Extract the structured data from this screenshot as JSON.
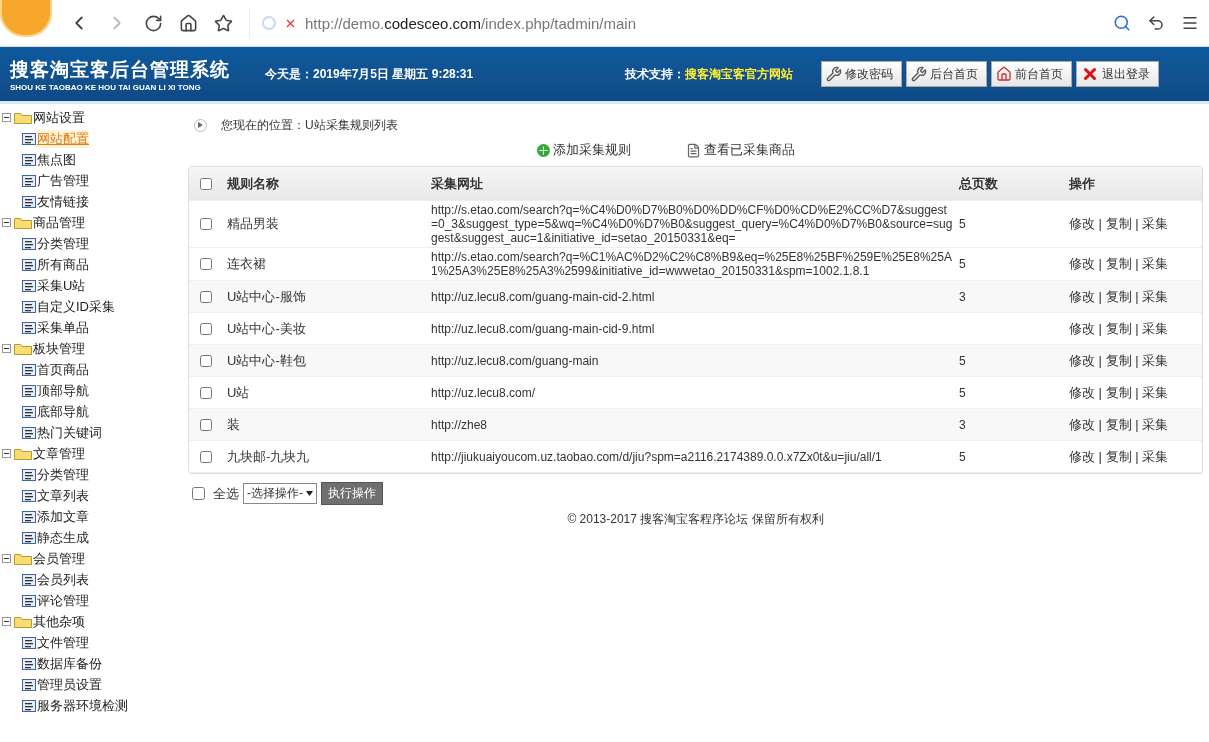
{
  "browser": {
    "url_prefix": "http://demo.",
    "url_domain": "codesceo.com",
    "url_path": "/index.php/tadmin/main"
  },
  "header": {
    "title": "搜客淘宝客后台管理系统",
    "subtitle": "SHOU KE TAOBAO KE HOU TAI GUAN LI XI TONG",
    "date": "今天是：2019年7月5日 星期五 9:28:31",
    "support_label": "技术支持：",
    "support_link": "搜客淘宝客官方网站",
    "buttons": [
      {
        "label": "修改密码",
        "kind": "tools"
      },
      {
        "label": "后台首页",
        "kind": "tools"
      },
      {
        "label": "前台首页",
        "kind": "home"
      },
      {
        "label": "退出登录",
        "kind": "logout"
      }
    ]
  },
  "sidebar": {
    "groups": [
      {
        "label": "网站设置",
        "expanded": true,
        "children": [
          {
            "label": "网站配置",
            "selected": true
          },
          {
            "label": "焦点图",
            "selected": false
          },
          {
            "label": "广告管理",
            "selected": false
          },
          {
            "label": "友情链接",
            "selected": false
          }
        ]
      },
      {
        "label": "商品管理",
        "expanded": true,
        "children": [
          {
            "label": "分类管理",
            "selected": false
          },
          {
            "label": "所有商品",
            "selected": false
          },
          {
            "label": "采集U站",
            "selected": false
          },
          {
            "label": "自定义ID采集",
            "selected": false
          },
          {
            "label": "采集单品",
            "selected": false
          }
        ]
      },
      {
        "label": "板块管理",
        "expanded": true,
        "children": [
          {
            "label": "首页商品",
            "selected": false
          },
          {
            "label": "顶部导航",
            "selected": false
          },
          {
            "label": "底部导航",
            "selected": false
          },
          {
            "label": "热门关键词",
            "selected": false
          }
        ]
      },
      {
        "label": "文章管理",
        "expanded": true,
        "children": [
          {
            "label": "分类管理",
            "selected": false
          },
          {
            "label": "文章列表",
            "selected": false
          },
          {
            "label": "添加文章",
            "selected": false
          },
          {
            "label": "静态生成",
            "selected": false
          }
        ]
      },
      {
        "label": "会员管理",
        "expanded": true,
        "children": [
          {
            "label": "会员列表",
            "selected": false
          },
          {
            "label": "评论管理",
            "selected": false
          }
        ]
      },
      {
        "label": "其他杂项",
        "expanded": true,
        "children": [
          {
            "label": "文件管理",
            "selected": false
          },
          {
            "label": "数据库备份",
            "selected": false
          },
          {
            "label": "管理员设置",
            "selected": false
          },
          {
            "label": "服务器环境检测",
            "selected": false
          }
        ]
      }
    ]
  },
  "breadcrumb": "您现在的位置：U站采集规则列表",
  "toolbar": [
    {
      "label": "添加采集规则",
      "kind": "add"
    },
    {
      "label": "查看已采集商品",
      "kind": "document"
    }
  ],
  "table": {
    "columns": [
      "规则名称",
      "采集网址",
      "总页数",
      "操作"
    ],
    "all_checked": false,
    "rows": [
      {
        "name": "精品男装",
        "url": "http://s.etao.com/search?q=%C4%D0%D7%B0%D0%DD%CF%D0%CD%E2%CC%D7&suggest=0_3&suggest_type=5&wq=%C4%D0%D7%B0&suggest_query=%C4%D0%D7%B0&source=suggest&suggest_auc=1&initiative_id=setao_20150331&eq=",
        "pages": "5",
        "actions": "修改 | 复制 | 采集",
        "checked": false
      },
      {
        "name": "连衣裙",
        "url": "http://s.etao.com/search?q=%C1%AC%D2%C2%C8%B9&eq=%25E8%25BF%259E%25E8%25A1%25A3%25E8%25A3%2599&initiative_id=wwwetao_20150331&spm=1002.1.8.1",
        "pages": "5",
        "actions": "修改 | 复制 | 采集",
        "checked": false
      },
      {
        "name": "U站中心-服饰",
        "url": "http://uz.lecu8.com/guang-main-cid-2.html",
        "pages": "3",
        "actions": "修改 | 复制 | 采集",
        "checked": false
      },
      {
        "name": "U站中心-美妆",
        "url": "http://uz.lecu8.com/guang-main-cid-9.html",
        "actions": "修改 | 复制 | 采集",
        "checked": false
      },
      {
        "name": "U站中心-鞋包",
        "url": "http://uz.lecu8.com/guang-main",
        "pages": "5",
        "actions": "修改 | 复制 | 采集",
        "checked": false
      },
      {
        "name": "U站",
        "url": "http://uz.lecu8.com/",
        "pages": "5",
        "actions": "修改 | 复制 | 采集",
        "checked": false
      },
      {
        "name": "装",
        "url": "http://zhe8",
        "pages": "3",
        "actions": "修改 | 复制 | 采集",
        "checked": false
      },
      {
        "name": "九块邮-九块九",
        "url": "http://jiukuaiyoucom.uz.taobao.com/d/jiu?spm=a2116.2174389.0.0.x7Zx0t&u=jiu/all/1",
        "pages": "5",
        "actions": "修改 | 复制 | 采集",
        "checked": false
      }
    ]
  },
  "footer_bar": {
    "select_all": "全选",
    "select_all_checked": false,
    "select": "-选择操作-",
    "submit": "执行操作"
  },
  "copyright": "© 2013-2017 搜客淘宝客程序论坛 保留所有权利"
}
